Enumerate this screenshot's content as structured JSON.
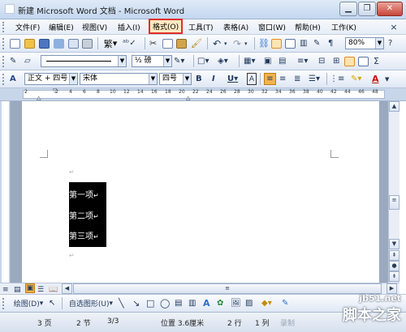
{
  "window": {
    "title": "新建 Microsoft Word 文档 - Microsoft Word"
  },
  "menu": {
    "items": [
      "文件(F)",
      "编辑(E)",
      "视图(V)",
      "插入(I)",
      "格式(O)",
      "工具(T)",
      "表格(A)",
      "窗口(W)",
      "帮助(H)",
      "工作(K)"
    ],
    "highlighted_index": 4
  },
  "standard_toolbar": {
    "trad_label": "繁",
    "zoom": "80%"
  },
  "tables_toolbar": {
    "line_weight": "½ 磅"
  },
  "formatting_toolbar": {
    "style": "正文 + 四号",
    "font": "宋体",
    "size": "四号",
    "bold": "B",
    "italic": "I",
    "underline": "U",
    "char_border": "A",
    "sum": "Σ"
  },
  "ruler": {
    "ticks": [
      "2",
      "2",
      "4",
      "6",
      "8",
      "10",
      "12",
      "14",
      "16",
      "18",
      "20",
      "22",
      "24",
      "26",
      "28",
      "30",
      "32",
      "34",
      "36",
      "38",
      "40",
      "42",
      "44",
      "46",
      "48"
    ]
  },
  "document": {
    "lines": [
      "第一项",
      "第二项",
      "第三项"
    ],
    "paragraph_mark": "↵"
  },
  "drawing_toolbar": {
    "draw_label": "绘图(D)",
    "autoshapes_label": "自选图形(U)"
  },
  "status": {
    "page": "3 页",
    "section": "2 节",
    "page_of": "3/3",
    "position": "位置 3.6厘米",
    "line": "2 行",
    "column": "1 列",
    "recording": "录制"
  },
  "watermark": {
    "site": "jb51.net",
    "name": "脚本之家"
  },
  "colors": {
    "menu_highlight": "#e0302a",
    "selection": "#000000",
    "accent_orange": "#e88a1a"
  }
}
